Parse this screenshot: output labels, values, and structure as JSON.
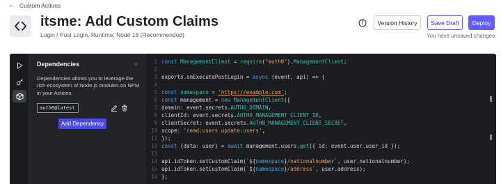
{
  "nav": {
    "back_label": "Custom Actions"
  },
  "header": {
    "title": "itsme: Add Custom Claims",
    "subtitle": "Login / Post Login, Runtime: Node 18 (Recommended)",
    "version_history": "Version History",
    "save_draft": "Save Draft",
    "deploy": "Deploy",
    "unsaved": "You have unsaved changes"
  },
  "dependencies": {
    "title": "Dependencies",
    "close": "×",
    "description": "Dependencies allows you to leverage the rich ecosystem of Node.js modules on NPM in your Actions.",
    "items": [
      {
        "name": "auth0@latest"
      }
    ],
    "add_label": "Add Dependency"
  },
  "colors": {
    "accent": "#635dff",
    "editor_bg": "#1c1d21"
  },
  "code": {
    "lines": [
      {
        "n": "1",
        "segs": [
          [
            "kw",
            "const "
          ],
          [
            "fn",
            "ManagementClient"
          ],
          [
            "txt",
            " = "
          ],
          [
            "fn",
            "require"
          ],
          [
            "txt",
            "("
          ],
          [
            "str",
            "\"auth0\""
          ],
          [
            "txt",
            ")."
          ],
          [
            "fn",
            "ManagementClient"
          ],
          [
            "txt",
            ";"
          ]
        ]
      },
      {
        "n": "2",
        "segs": []
      },
      {
        "n": "3",
        "segs": [
          [
            "txt",
            "exports.onExecutePostLogin = "
          ],
          [
            "kw",
            "async"
          ],
          [
            "txt",
            " (event, api) => {"
          ]
        ]
      },
      {
        "n": "4",
        "segs": []
      },
      {
        "n": "5",
        "segs": [
          [
            "kw",
            "const "
          ],
          [
            "fn",
            "namespace"
          ],
          [
            "txt",
            " = "
          ],
          [
            "url",
            "'https://example.com'"
          ],
          [
            "txt",
            ";"
          ]
        ]
      },
      {
        "n": "6",
        "segs": [
          [
            "kw",
            "const "
          ],
          [
            "txt",
            "management = "
          ],
          [
            "kw",
            "new "
          ],
          [
            "fn",
            "ManagementClient"
          ],
          [
            "txt",
            "({"
          ]
        ]
      },
      {
        "n": "7",
        "segs": [
          [
            "txt",
            "domain: event.secrets."
          ],
          [
            "fn",
            "AUTH0_DOMAIN"
          ],
          [
            "txt",
            ","
          ]
        ]
      },
      {
        "n": "8",
        "segs": [
          [
            "txt",
            "clientId: event.secrets."
          ],
          [
            "fn",
            "AUTH0_MANAGEMENT_CLIENT_ID"
          ],
          [
            "txt",
            ","
          ]
        ]
      },
      {
        "n": "9",
        "segs": [
          [
            "txt",
            "clientSecret: event.secrets."
          ],
          [
            "fn",
            "AUTH0_MANAGEMENT_CLIENT_SECRET"
          ],
          [
            "txt",
            ","
          ]
        ]
      },
      {
        "n": "10",
        "segs": [
          [
            "txt",
            "scope: "
          ],
          [
            "str",
            "'read:users update:users'"
          ],
          [
            "txt",
            ","
          ]
        ]
      },
      {
        "n": "11",
        "segs": [
          [
            "txt",
            "});"
          ]
        ]
      },
      {
        "n": "12",
        "segs": [
          [
            "kw",
            "const "
          ],
          [
            "txt",
            "{data: user} = "
          ],
          [
            "kw",
            "await "
          ],
          [
            "txt",
            "management.users."
          ],
          [
            "fn",
            "get"
          ],
          [
            "txt",
            "({ id: event.user.user_id });"
          ]
        ]
      },
      {
        "n": "13",
        "segs": []
      },
      {
        "n": "14",
        "segs": [
          [
            "txt",
            "api.idToken.setCustomClaim(`${"
          ],
          [
            "kw",
            "namespace"
          ],
          [
            "txt",
            "}"
          ],
          [
            "str",
            "/nationalnumber"
          ],
          [
            "txt",
            "`, user.nationalnumber);"
          ]
        ]
      },
      {
        "n": "15",
        "segs": [
          [
            "txt",
            "api.idToken.setCustomClaim(`${"
          ],
          [
            "kw",
            "namespace"
          ],
          [
            "txt",
            "}"
          ],
          [
            "str",
            "/address"
          ],
          [
            "txt",
            "`, user.address);"
          ]
        ]
      },
      {
        "n": "16",
        "segs": [
          [
            "txt",
            "};"
          ]
        ]
      }
    ]
  }
}
